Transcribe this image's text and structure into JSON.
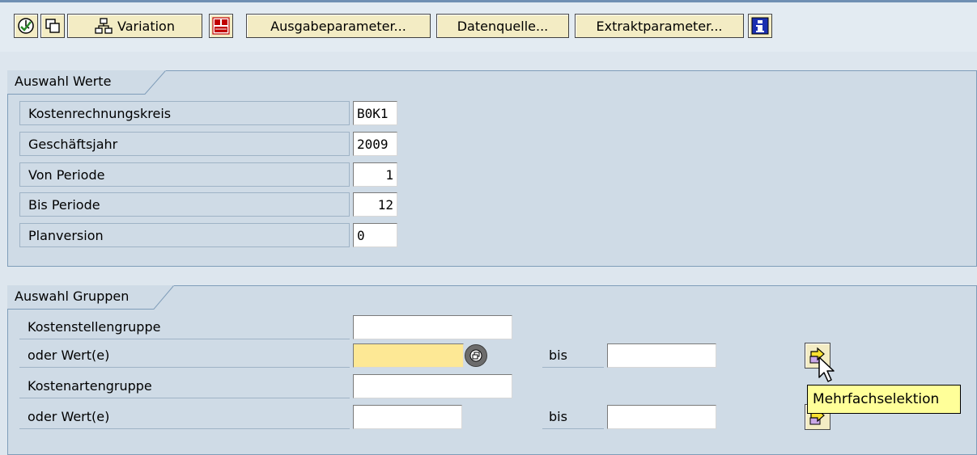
{
  "toolbar": {
    "icons": [
      "execute-icon",
      "copy-icon",
      "hierarchy-icon",
      "data-table-icon",
      "info-icon"
    ],
    "variation_label": "Variation",
    "ausgabeparameter_label": "Ausgabeparameter...",
    "datenquelle_label": "Datenquelle...",
    "extraktparameter_label": "Extraktparameter..."
  },
  "auswahl_werte": {
    "title": "Auswahl Werte",
    "rows": [
      {
        "label": "Kostenrechnungskreis",
        "value": "B0K1"
      },
      {
        "label": "Geschäftsjahr",
        "value": "2009"
      },
      {
        "label": "Von Periode",
        "value": "1"
      },
      {
        "label": "Bis Periode",
        "value": "12"
      },
      {
        "label": "Planversion",
        "value": "0"
      }
    ]
  },
  "auswahl_gruppen": {
    "title": "Auswahl Gruppen",
    "rows": [
      {
        "label": "Kostenstellengruppe",
        "value": ""
      },
      {
        "label": "oder Wert(e)",
        "value": "",
        "bis_label": "bis",
        "bis_value": ""
      },
      {
        "label": "Kostenartengruppe",
        "value": ""
      },
      {
        "label": "oder Wert(e)",
        "value": "",
        "bis_label": "bis",
        "bis_value": ""
      }
    ]
  },
  "tooltip": "Mehrfachselektion",
  "colors": {
    "background": "#dde6ee",
    "frame": "#cfdbe6",
    "button": "#f3ecc4",
    "highlight_field": "#fde895",
    "tooltip": "#ffff99"
  }
}
